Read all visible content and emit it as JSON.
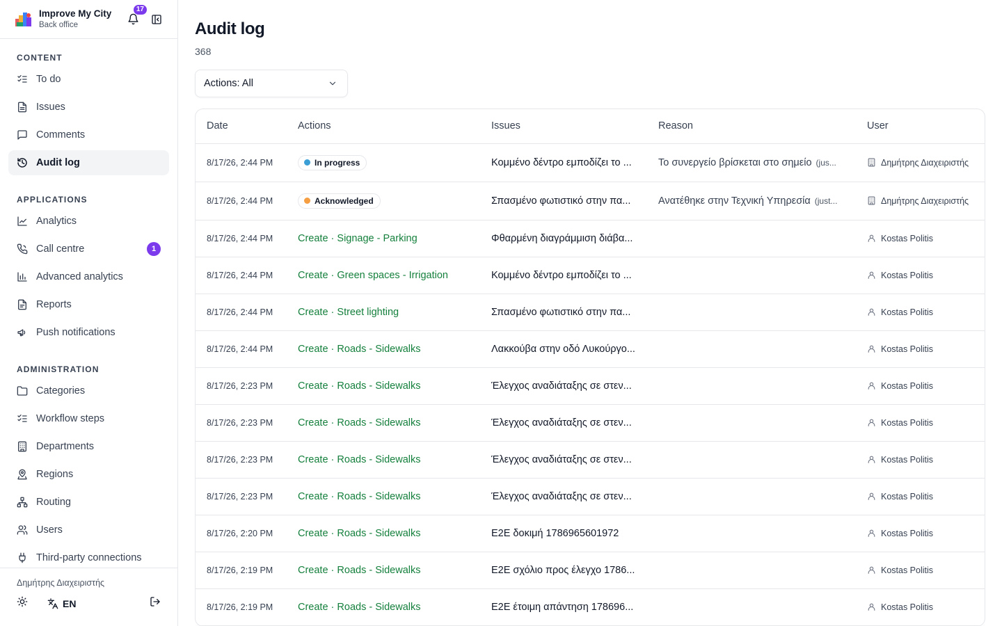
{
  "brand": {
    "title": "Improve My City",
    "subtitle": "Back office",
    "notification_count": "17"
  },
  "sidebar": {
    "sections": {
      "content": "CONTENT",
      "applications": "APPLICATIONS",
      "administration": "ADMINISTRATION"
    },
    "items": {
      "todo": "To do",
      "issues": "Issues",
      "comments": "Comments",
      "audit_log": "Audit log",
      "analytics": "Analytics",
      "call_centre": "Call centre",
      "call_centre_badge": "1",
      "advanced_analytics": "Advanced analytics",
      "reports": "Reports",
      "push_notifications": "Push notifications",
      "categories": "Categories",
      "workflow_steps": "Workflow steps",
      "departments": "Departments",
      "regions": "Regions",
      "routing": "Routing",
      "users": "Users",
      "third_party": "Third-party connections"
    },
    "footer": {
      "user": "Δημήτρης Διαχειριστής",
      "language": "EN"
    }
  },
  "main": {
    "title": "Audit log",
    "count": "368",
    "filter_label": "Actions: All",
    "columns": {
      "date": "Date",
      "actions": "Actions",
      "issues": "Issues",
      "reason": "Reason",
      "user": "User"
    },
    "status_colors": {
      "in_progress": "#3b9fd6",
      "acknowledged": "#f59e42",
      "action_link": "#15803d"
    },
    "rows": [
      {
        "date": "8/17/26, 2:44 PM",
        "action": "In progress",
        "issue": "Κομμένο δέντρο εμποδίζει το ...",
        "reason": "Το συνεργείο βρίσκεται στο σημείο",
        "reason_note": "(jus...",
        "user": "Δημήτρης Διαχειριστής"
      },
      {
        "date": "8/17/26, 2:44 PM",
        "action": "Acknowledged",
        "issue": "Σπασμένο φωτιστικό στην πα...",
        "reason": "Ανατέθηκε στην Τεχνική Υπηρεσία",
        "reason_note": "(just...",
        "user": "Δημήτρης Διαχειριστής"
      },
      {
        "date": "8/17/26, 2:44 PM",
        "action": "Create · Signage - Parking",
        "issue": "Φθαρμένη διαγράμμιση διάβα...",
        "user": "Kostas Politis"
      },
      {
        "date": "8/17/26, 2:44 PM",
        "action": "Create · Green spaces - Irrigation",
        "issue": "Κομμένο δέντρο εμποδίζει το ...",
        "user": "Kostas Politis"
      },
      {
        "date": "8/17/26, 2:44 PM",
        "action": "Create · Street lighting",
        "issue": "Σπασμένο φωτιστικό στην πα...",
        "user": "Kostas Politis"
      },
      {
        "date": "8/17/26, 2:44 PM",
        "action": "Create · Roads - Sidewalks",
        "issue": "Λακκούβα στην οδό Λυκούργο...",
        "user": "Kostas Politis"
      },
      {
        "date": "8/17/26, 2:23 PM",
        "action": "Create · Roads - Sidewalks",
        "issue": "Έλεγχος αναδιάταξης σε στεν...",
        "user": "Kostas Politis"
      },
      {
        "date": "8/17/26, 2:23 PM",
        "action": "Create · Roads - Sidewalks",
        "issue": "Έλεγχος αναδιάταξης σε στεν...",
        "user": "Kostas Politis"
      },
      {
        "date": "8/17/26, 2:23 PM",
        "action": "Create · Roads - Sidewalks",
        "issue": "Έλεγχος αναδιάταξης σε στεν...",
        "user": "Kostas Politis"
      },
      {
        "date": "8/17/26, 2:23 PM",
        "action": "Create · Roads - Sidewalks",
        "issue": "Έλεγχος αναδιάταξης σε στεν...",
        "user": "Kostas Politis"
      },
      {
        "date": "8/17/26, 2:20 PM",
        "action": "Create · Roads - Sidewalks",
        "issue": "E2E δοκιμή 1786965601972",
        "user": "Kostas Politis"
      },
      {
        "date": "8/17/26, 2:19 PM",
        "action": "Create · Roads - Sidewalks",
        "issue": "E2E σχόλιο προς έλεγχο 1786...",
        "user": "Kostas Politis"
      },
      {
        "date": "8/17/26, 2:19 PM",
        "action": "Create · Roads - Sidewalks",
        "issue": "E2E έτοιμη απάντηση 178696...",
        "user": "Kostas Politis"
      }
    ]
  }
}
